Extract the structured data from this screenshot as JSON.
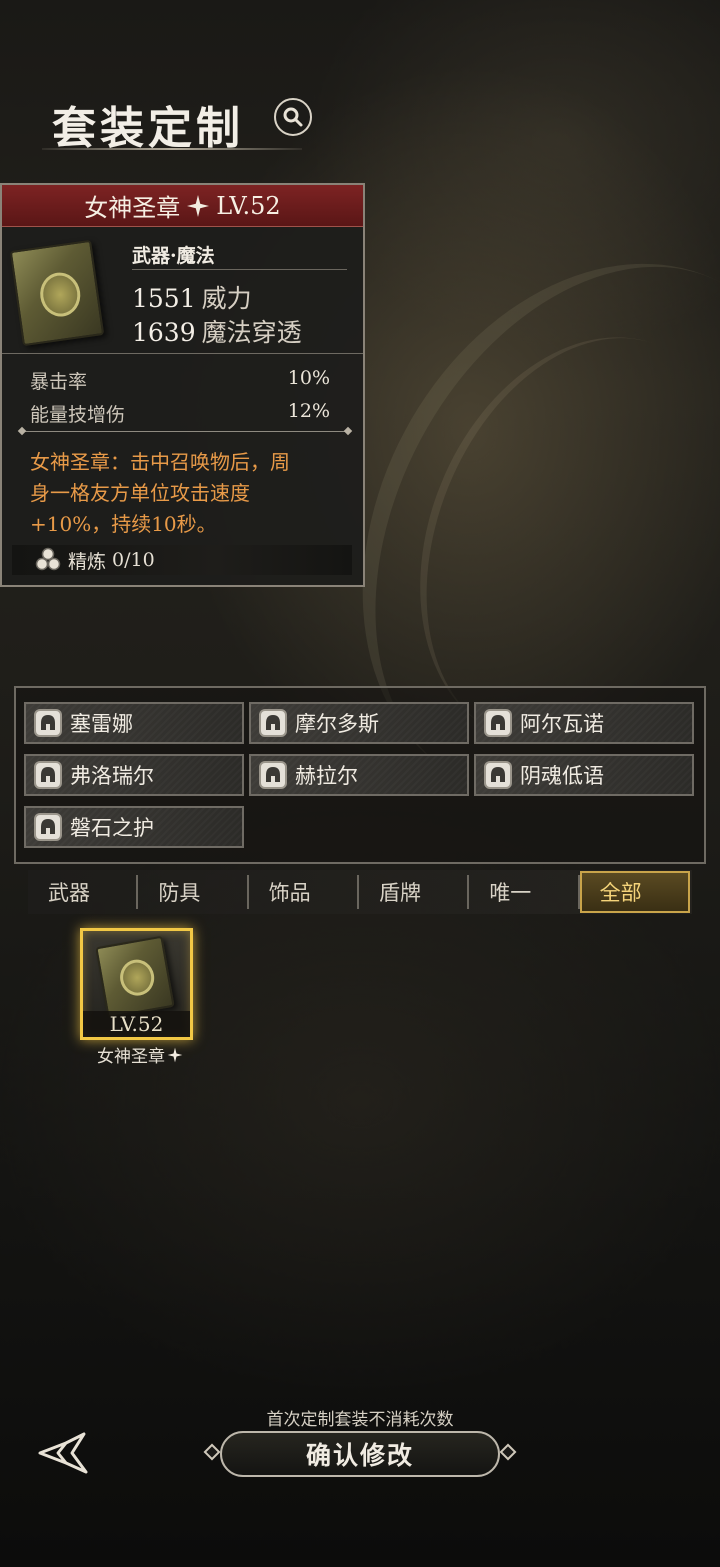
{
  "header": {
    "title": "套装定制"
  },
  "item": {
    "name": "女神圣章",
    "level": "LV.52",
    "type": "武器·魔法",
    "main_stats": [
      {
        "value": "1551",
        "label": "威力"
      },
      {
        "value": "1639",
        "label": "魔法穿透"
      }
    ],
    "sub_stats": [
      {
        "label": "暴击率",
        "value": "10%"
      },
      {
        "label": "能量技增伤",
        "value": "12%"
      }
    ],
    "effect_lines": [
      "女神圣章：击中召唤物后，周",
      "身一格友方单位攻击速度",
      "+10%，持续10秒。"
    ],
    "refine": {
      "label": "精炼",
      "value": "0/10"
    }
  },
  "heroes": [
    "塞雷娜",
    "摩尔多斯",
    "阿尔瓦诺",
    "弗洛瑞尔",
    "赫拉尔",
    "阴魂低语",
    "磐石之护"
  ],
  "tabs": [
    "武器",
    "防具",
    "饰品",
    "盾牌",
    "唯一",
    "全部"
  ],
  "active_tab": "全部",
  "inventory": [
    {
      "name": "女神圣章",
      "level": "LV.52",
      "selected": true
    }
  ],
  "footer": {
    "hint": "首次定制套装不消耗次数",
    "confirm_label": "确认修改"
  },
  "colors": {
    "accent_gold": "#f2c845",
    "effect_orange": "#e89a48",
    "header_red": "#7d2323"
  }
}
